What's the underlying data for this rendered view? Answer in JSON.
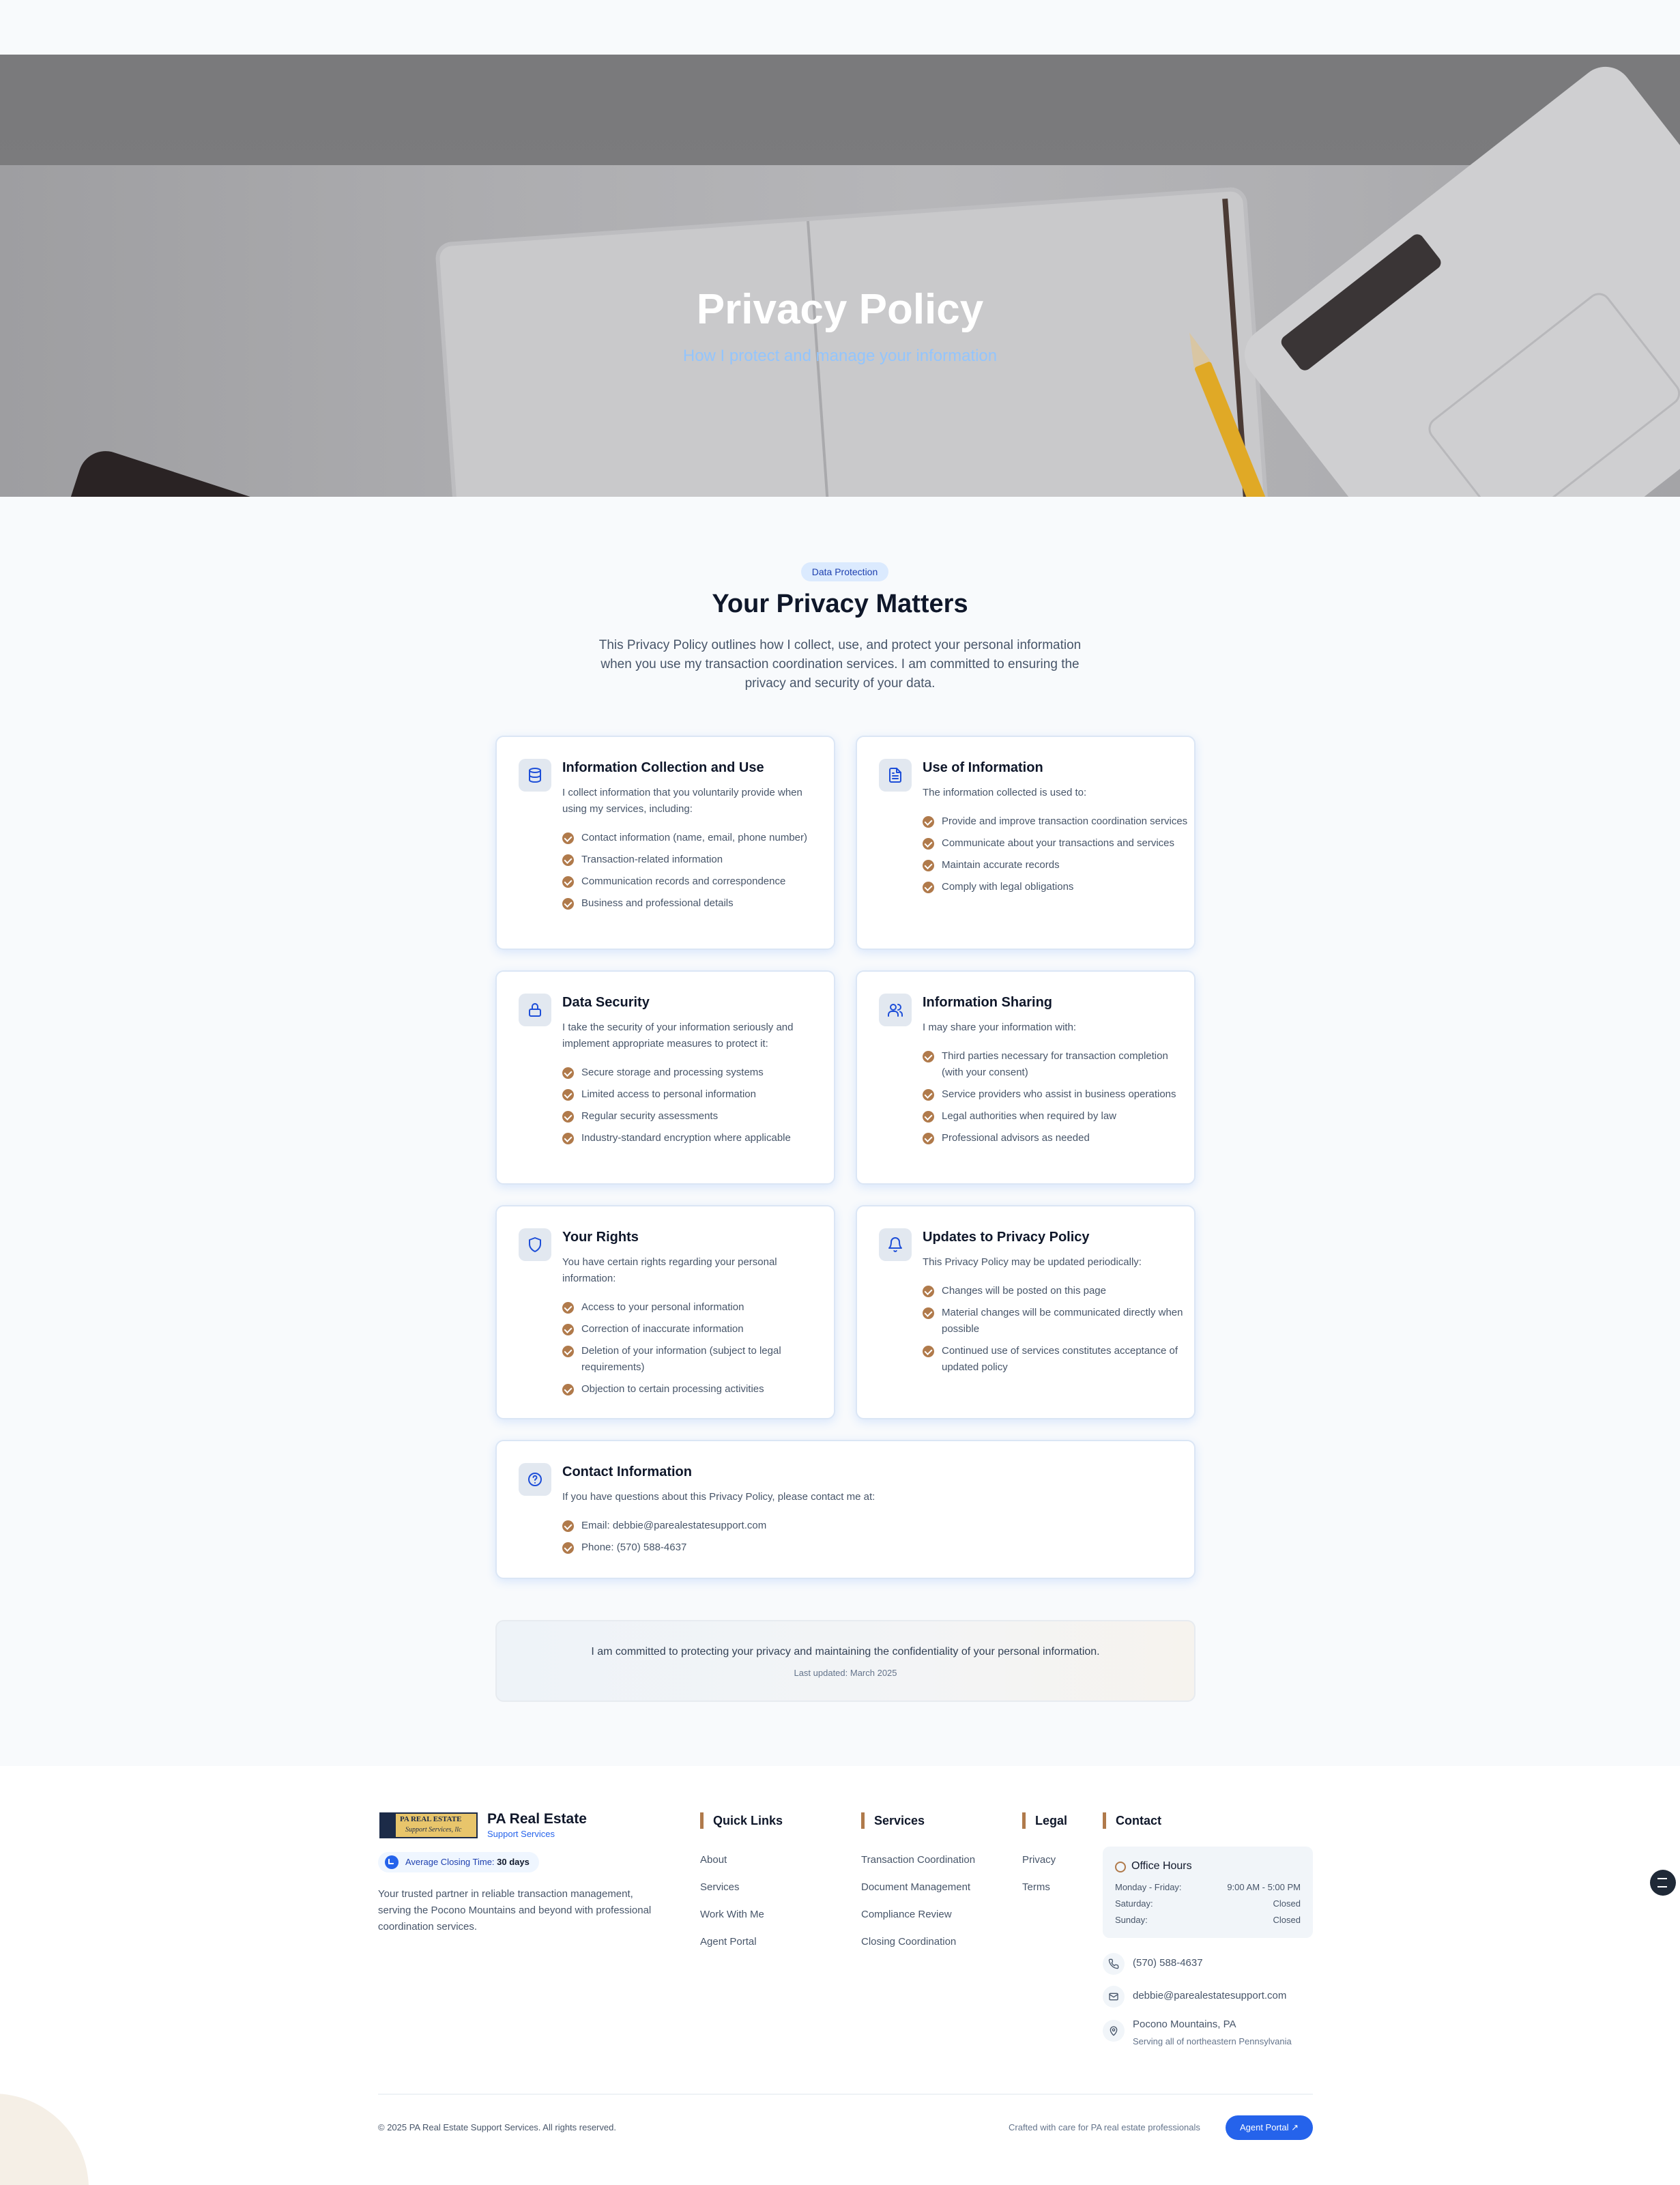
{
  "hero": {
    "title": "Privacy Policy",
    "subtitle": "How I protect and manage your information"
  },
  "intro": {
    "badge": "Data Protection",
    "title": "Your Privacy Matters",
    "text": "This Privacy Policy outlines how I collect, use, and protect your personal information when you use my transaction coordination services. I am committed to ensuring the privacy and security of your data."
  },
  "cards": [
    {
      "icon": "database-icon",
      "title": "Information Collection and Use",
      "desc": "I collect information that you voluntarily provide when using my services, including:",
      "items": [
        "Contact information (name, email, phone number)",
        "Transaction-related information",
        "Communication records and correspondence",
        "Business and professional details"
      ]
    },
    {
      "icon": "document-icon",
      "title": "Use of Information",
      "desc": "The information collected is used to:",
      "items": [
        "Provide and improve transaction coordination services",
        "Communicate about your transactions and services",
        "Maintain accurate records",
        "Comply with legal obligations"
      ]
    },
    {
      "icon": "lock-icon",
      "title": "Data Security",
      "desc": "I take the security of your information seriously and implement appropriate measures to protect it:",
      "items": [
        "Secure storage and processing systems",
        "Limited access to personal information",
        "Regular security assessments",
        "Industry-standard encryption where applicable"
      ]
    },
    {
      "icon": "users-icon",
      "title": "Information Sharing",
      "desc": "I may share your information with:",
      "items": [
        "Third parties necessary for transaction completion (with your consent)",
        "Service providers who assist in business operations",
        "Legal authorities when required by law",
        "Professional advisors as needed"
      ]
    },
    {
      "icon": "shield-icon",
      "title": "Your Rights",
      "desc": "You have certain rights regarding your personal information:",
      "items": [
        "Access to your personal information",
        "Correction of inaccurate information",
        "Deletion of your information (subject to legal requirements)",
        "Objection to certain processing activities"
      ]
    },
    {
      "icon": "bell-icon",
      "title": "Updates to Privacy Policy",
      "desc": "This Privacy Policy may be updated periodically:",
      "items": [
        "Changes will be posted on this page",
        "Material changes will be communicated directly when possible",
        "Continued use of services constitutes acceptance of updated policy"
      ]
    },
    {
      "icon": "help-icon",
      "title": "Contact Information",
      "desc": "If you have questions about this Privacy Policy, please contact me at:",
      "items": [
        "Email: debbie@parealestatesupport.com",
        "Phone: (570) 588-4637"
      ]
    }
  ],
  "commitment": {
    "text": "I am committed to protecting your privacy and maintaining the confidentiality of your personal information.",
    "updated": "Last updated: March 2025"
  },
  "footer": {
    "logo_line1": "PA REAL ESTATE",
    "logo_line2": "Support Services, llc",
    "brand_name": "PA Real Estate",
    "brand_sub": "Support Services",
    "closing_label": "Average Closing Time:",
    "closing_value": "30 days",
    "about": "Your trusted partner in reliable transaction management, serving the Pocono Mountains and beyond with professional coordination services.",
    "quick_links": {
      "title": "Quick Links",
      "items": [
        "About",
        "Services",
        "Work With Me",
        "Agent Portal"
      ]
    },
    "services": {
      "title": "Services",
      "items": [
        "Transaction Coordination",
        "Document Management",
        "Compliance Review",
        "Closing Coordination"
      ]
    },
    "legal": {
      "title": "Legal",
      "items": [
        "Privacy",
        "Terms"
      ]
    },
    "contact": {
      "title": "Contact",
      "hours_title": "Office Hours",
      "hours": [
        {
          "day": "Monday - Friday:",
          "time": "9:00 AM - 5:00 PM"
        },
        {
          "day": "Saturday:",
          "time": "Closed"
        },
        {
          "day": "Sunday:",
          "time": "Closed"
        }
      ],
      "phone": "(570) 588-4637",
      "email": "debbie@parealestatesupport.com",
      "location": "Pocono Mountains, PA",
      "location_sub": "Serving all of northeastern Pennsylvania"
    },
    "copyright": "© 2025 PA Real Estate Support Services. All rights reserved.",
    "crafted": "Crafted with care for PA real estate professionals",
    "agent_portal": "Agent Portal"
  },
  "colors": {
    "accent": "#2563eb",
    "bullet": "#b07a4b",
    "heading": "#0f172a"
  }
}
